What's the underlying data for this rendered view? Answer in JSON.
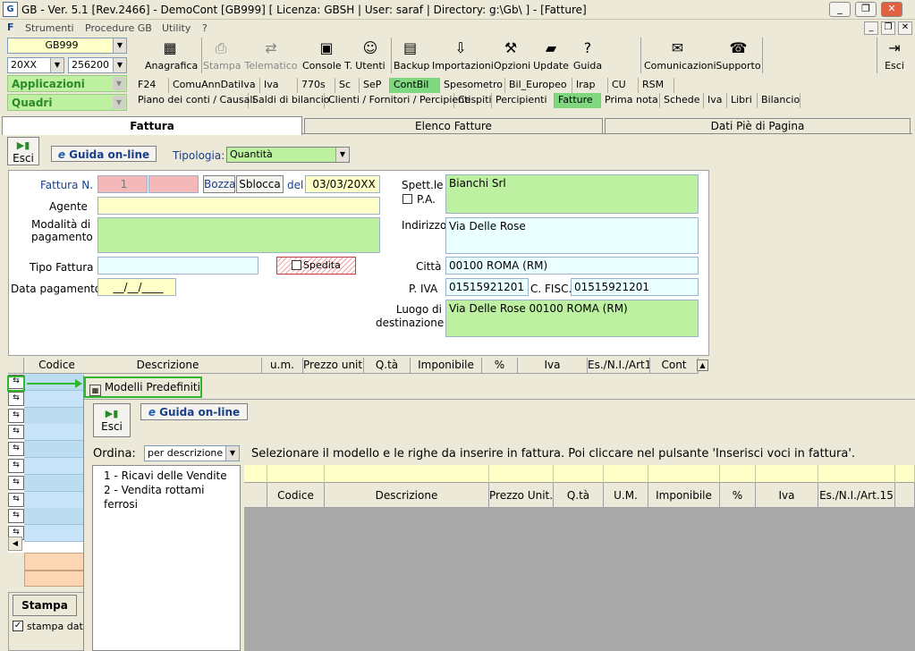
{
  "window": {
    "title": "GB - Ver. 5.1 [Rev.2466] -  DemoCont [GB999]    [ Licenza: GBSH | User: saraf | Directory: g:\\Gb\\ ] - [Fatture]",
    "logo": "G",
    "minimize": "_",
    "restore": "❐",
    "close": "✕"
  },
  "menu": {
    "doc_icon": "F",
    "items": [
      "Strumenti",
      "Procedure GB",
      "Utility",
      "?"
    ]
  },
  "left": {
    "company": "GB999",
    "year": "20XX",
    "account": "256200 -",
    "applicazioni": "Applicazioni",
    "quadri": "Quadri"
  },
  "toolbar": [
    {
      "label": "Anagrafica",
      "icon": "▦"
    },
    {
      "label": "Stampa",
      "icon": "⎙"
    },
    {
      "label": "Telematico",
      "icon": "⇄"
    },
    {
      "label": "Console T.",
      "icon": "▣"
    },
    {
      "label": "Utenti",
      "icon": "☺"
    },
    {
      "label": "Backup",
      "icon": "▤"
    },
    {
      "label": "Importazioni",
      "icon": "⇩"
    },
    {
      "label": "Opzioni",
      "icon": "⚒"
    },
    {
      "label": "Update",
      "icon": "▰"
    },
    {
      "label": "Guida",
      "icon": "?"
    },
    {
      "label": "Comunicazioni",
      "icon": "✉"
    },
    {
      "label": "Supporto",
      "icon": "☎"
    },
    {
      "label": "Esci",
      "icon": "⇥"
    }
  ],
  "tabs_row1": [
    "F24",
    "ComuAnnDatiIva",
    "Iva",
    "770s",
    "Sc",
    "SeP",
    "ContBil",
    "Spesometro",
    "Bil_Europeo",
    "Irap",
    "CU",
    "RSM"
  ],
  "tabs_row2": [
    "Piano dei conti / Causali",
    "Saldi di bilancio",
    "Clienti / Fornitori / Percipienti",
    "Cespiti",
    "Percipienti",
    "Fatture",
    "Prima nota",
    "Schede",
    "Iva",
    "Libri",
    "Bilancio"
  ],
  "pagetabs": [
    "Fattura",
    "Elenco Fatture",
    "Dati Piè di Pagina"
  ],
  "form": {
    "esci": "Esci",
    "guida": "Guida on-line",
    "tipologia_label": "Tipologia:",
    "tipologia_value": "Quantità",
    "fattura_n_label": "Fattura N.",
    "fattura_n_value": "1",
    "bozza": "Bozza",
    "sblocca": "Sblocca",
    "del_label": "del",
    "date": "03/03/20XX",
    "agente_label": "Agente",
    "modalita_label": "Modalità di pagamento",
    "tipo_fattura_label": "Tipo Fattura",
    "spedita": "Spedita",
    "data_pagamento_label": "Data pagamento",
    "data_pagamento_value": "__/__/____",
    "spett_label": "Spett.le",
    "spett_value": "Bianchi Srl",
    "pa_label": "P.A.",
    "indirizzo_label": "Indirizzo",
    "indirizzo_value": "Via Delle Rose",
    "citta_label": "Città",
    "citta_value": "00100  ROMA (RM)",
    "piva_label": "P. IVA",
    "piva_value": "01515921201",
    "cfisc_label": "C. FISC.",
    "cfisc_value": "01515921201",
    "luogo_label": "Luogo di destinazione",
    "luogo_value": "Via Delle Rose 00100  ROMA (RM)"
  },
  "grid_headers": [
    "Codice",
    "Descrizione",
    "u.m.",
    "Prezzo unit.",
    "Q.tà",
    "Imponibile",
    "%",
    "Iva",
    "Es./N.I./Art1",
    "Cont"
  ],
  "bottom": {
    "stampa": "Stampa",
    "stampa_dati": "stampa dati i"
  },
  "dialog": {
    "title": "Modelli Predefiniti",
    "esci": "Esci",
    "guida": "Guida on-line",
    "ordina_label": "Ordina:",
    "ordina_value": "per descrizione",
    "instruction": "Selezionare il modello e le righe da inserire in fattura. Poi cliccare nel pulsante 'Inserisci voci in fattura'.",
    "models": [
      "1 - Ricavi delle Vendite",
      "2 - Vendita rottami ferrosi"
    ],
    "headers": [
      "Codice",
      "Descrizione",
      "Prezzo Unit.",
      "Q.tà",
      "U.M.",
      "Imponibile",
      "%",
      "Iva",
      "Es./N.I./Art.15"
    ]
  },
  "colors": {
    "accent_green": "#2eb82e",
    "light_green": "#bdf0a0",
    "pink": "#f4b8b8",
    "yellow": "#ffffc8",
    "cyan": "#eaffff"
  }
}
